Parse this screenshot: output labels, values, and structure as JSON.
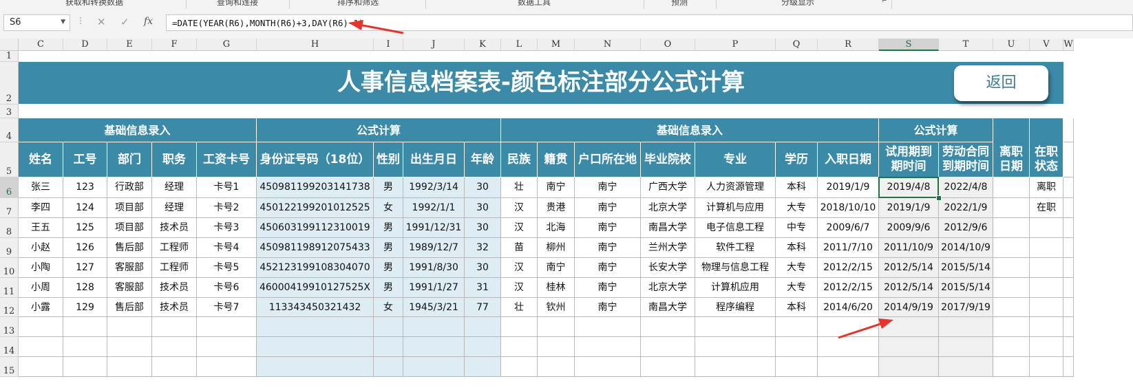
{
  "ribbon": {
    "groups": [
      "获取和转换数据",
      "查询和连接",
      "排序和筛选",
      "数据工具",
      "预测",
      "分级显示"
    ]
  },
  "formula_bar": {
    "name_box": "S6",
    "cancel_icon": "✕",
    "enter_icon": "✓",
    "fx_label": "fx",
    "formula": "=DATE(YEAR(R6),MONTH(R6)+3,DAY(R6)-1)"
  },
  "columns": [
    "C",
    "D",
    "E",
    "F",
    "G",
    "H",
    "I",
    "J",
    "K",
    "L",
    "M",
    "N",
    "O",
    "P",
    "Q",
    "R",
    "S",
    "T",
    "U",
    "V",
    "W"
  ],
  "selected_column": "S",
  "rows": [
    "1",
    "2",
    "3",
    "4",
    "5",
    "6",
    "7",
    "8",
    "9",
    "10",
    "11",
    "12",
    "13",
    "14",
    "15"
  ],
  "selected_row": "6",
  "sheet": {
    "title": "人事信息档案表-颜色标注部分公式计算",
    "back_button": "返回",
    "group_headers": [
      "基础信息录入",
      "公式计算",
      "基础信息录入",
      "公式计算"
    ],
    "headers": [
      "姓名",
      "工号",
      "部门",
      "职务",
      "工资卡号",
      "身份证号码（18位）",
      "性别",
      "出生月日",
      "年龄",
      "民族",
      "籍贯",
      "户口所在地",
      "毕业院校",
      "专业",
      "学历",
      "入职日期",
      "试用期到期时间",
      "劳动合同到期时间",
      "离职日期",
      "在职状态"
    ],
    "records": [
      [
        "张三",
        "123",
        "行政部",
        "经理",
        "卡号1",
        "450981199203141738",
        "男",
        "1992/3/14",
        "30",
        "壮",
        "南宁",
        "南宁",
        "广西大学",
        "人力资源管理",
        "本科",
        "2019/1/9",
        "2019/4/8",
        "2022/4/8",
        "",
        "离职"
      ],
      [
        "李四",
        "124",
        "项目部",
        "经理",
        "卡号2",
        "450122199201012525",
        "女",
        "1992/1/1",
        "30",
        "汉",
        "贵港",
        "南宁",
        "北京大学",
        "计算机与应用",
        "大专",
        "2018/10/10",
        "2019/1/9",
        "2022/1/9",
        "",
        "在职"
      ],
      [
        "王五",
        "125",
        "项目部",
        "技术员",
        "卡号3",
        "450603199112310019",
        "男",
        "1991/12/31",
        "30",
        "汉",
        "北海",
        "南宁",
        "南昌大学",
        "电子信息工程",
        "中专",
        "2009/6/7",
        "2009/9/6",
        "2012/9/6",
        "",
        ""
      ],
      [
        "小赵",
        "126",
        "售后部",
        "工程师",
        "卡号4",
        "450981198912075433",
        "男",
        "1989/12/7",
        "32",
        "苗",
        "柳州",
        "南宁",
        "兰州大学",
        "软件工程",
        "本科",
        "2011/7/10",
        "2011/10/9",
        "2014/10/9",
        "",
        ""
      ],
      [
        "小陶",
        "127",
        "客服部",
        "工程师",
        "卡号5",
        "452123199108304070",
        "男",
        "1991/8/30",
        "30",
        "汉",
        "南宁",
        "南宁",
        "长安大学",
        "物理与信息工程",
        "大专",
        "2012/2/15",
        "2012/5/14",
        "2015/5/14",
        "",
        ""
      ],
      [
        "小周",
        "128",
        "客服部",
        "技术员",
        "卡号6",
        "46000419910127525X",
        "男",
        "1991/1/27",
        "31",
        "汉",
        "桂林",
        "南宁",
        "北京大学",
        "计算机应用",
        "大专",
        "2012/2/15",
        "2012/5/14",
        "2015/5/14",
        "",
        ""
      ],
      [
        "小露",
        "129",
        "售后部",
        "技术员",
        "卡号7",
        "113343450321432",
        "女",
        "1945/3/21",
        "77",
        "壮",
        "钦州",
        "南宁",
        "南昌大学",
        "程序编程",
        "本科",
        "2014/6/20",
        "2014/9/19",
        "2017/9/19",
        "",
        ""
      ]
    ]
  },
  "colors": {
    "header_fill": "#3b8aa8",
    "formula_fill": "#deedf3",
    "selection": "#217346",
    "annotation_arrow": "#e8332a"
  }
}
